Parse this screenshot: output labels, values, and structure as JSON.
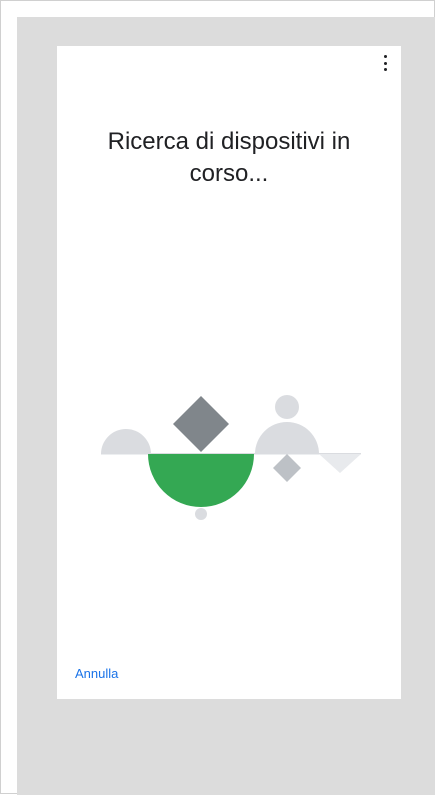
{
  "screen": {
    "title": "Ricerca di dispositivi in corso...",
    "menu_icon": "more-vert-icon",
    "illustration_icon": "device-search-illustration",
    "cancel_label": "Annulla"
  },
  "colors": {
    "accent_green": "#34a853",
    "dark_gray": "#80868b",
    "light_gray": "#dadce0",
    "link_blue": "#1a73e8",
    "background": "#dcdcdc"
  }
}
